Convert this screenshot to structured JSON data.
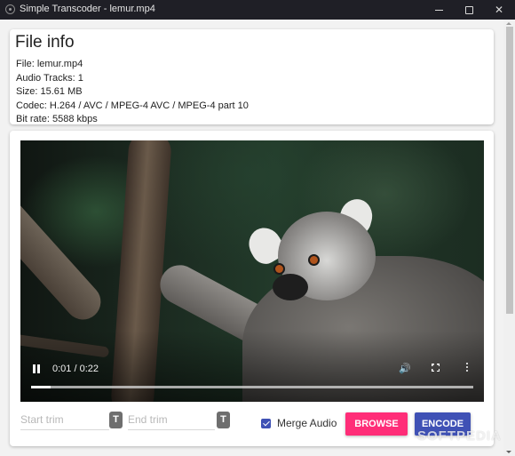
{
  "window": {
    "title": "Simple Transcoder - lemur.mp4",
    "app_icon": "gear-icon",
    "controls": {
      "minimize": "minimize-icon",
      "maximize": "maximize-icon",
      "close": "✕"
    }
  },
  "file_info": {
    "heading": "File info",
    "lines": [
      "File: lemur.mp4",
      "Audio Tracks: 1",
      "Size: 15.61 MB",
      "Codec: H.264 / AVC / MPEG-4 AVC / MPEG-4 part 10",
      "Bit rate: 5588 kbps"
    ]
  },
  "player": {
    "state": "playing",
    "play_pause_icon": "pause-icon",
    "time_display": "0:01 / 0:22",
    "current_time": "0:01",
    "duration": "0:22",
    "progress_fraction": 0.045,
    "volume_icon": "🔊",
    "fullscreen_icon": "fullscreen-icon",
    "more_icon": "more-vertical-icon"
  },
  "trim": {
    "start": {
      "placeholder": "Start trim",
      "value": "",
      "button_label": "T"
    },
    "end": {
      "placeholder": "End trim",
      "value": "",
      "button_label": "T"
    }
  },
  "options": {
    "merge_audio_label": "Merge Audio",
    "merge_audio_checked": true
  },
  "actions": {
    "browse_label": "BROWSE",
    "encode_label": "ENCODE"
  },
  "colors": {
    "browse": "#ff2d78",
    "encode": "#3f51b5",
    "checkbox": "#3f51b5",
    "titlebar": "#1f1f26"
  },
  "scrollbar": {
    "position_fraction": 0.0,
    "visible_fraction": 0.68
  },
  "watermark": "SOFTPEDIA"
}
